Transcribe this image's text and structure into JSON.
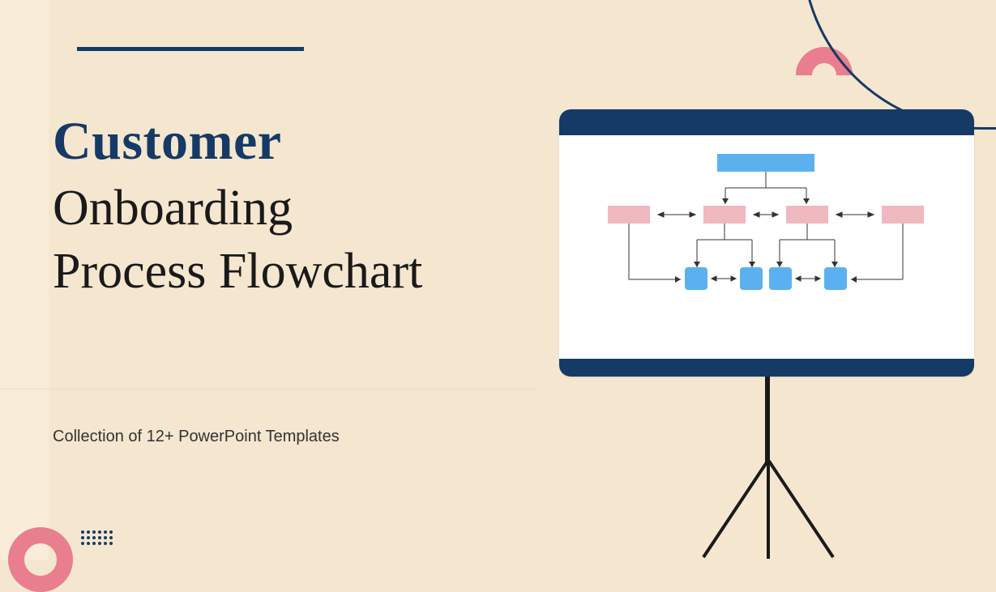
{
  "title": {
    "line1": "Customer",
    "line2": "Onboarding",
    "line3": "Process Flowchart"
  },
  "subtitle": "Collection of 12+ PowerPoint Templates",
  "colors": {
    "navy": "#163a66",
    "pink": "#e97e8e",
    "lightblue": "#5bb1f0",
    "softpink": "#f0b8bf",
    "background": "#f5e6d0"
  }
}
